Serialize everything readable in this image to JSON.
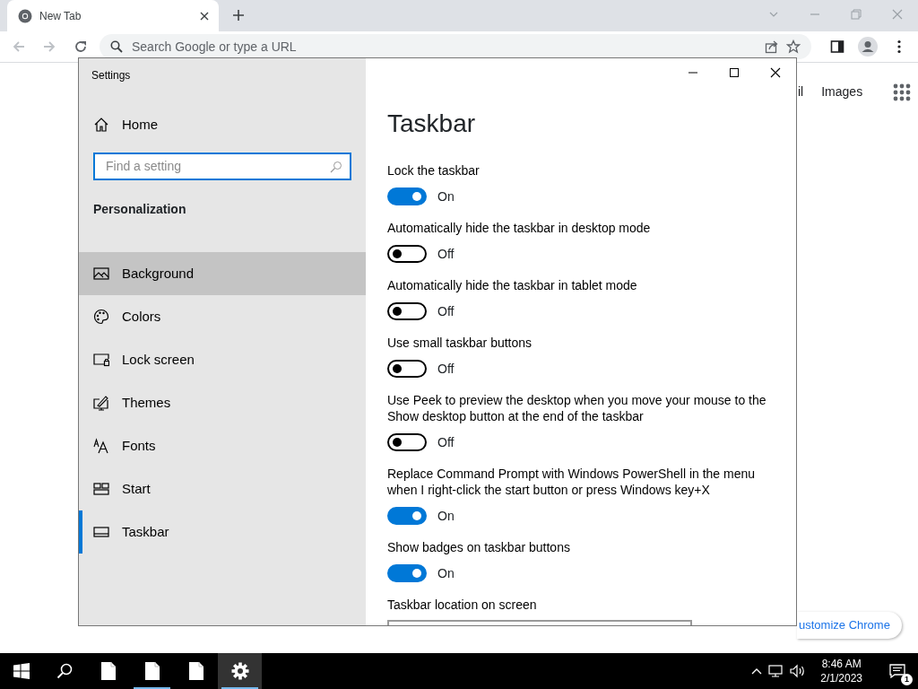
{
  "browser": {
    "tabs": [
      {
        "title": "New Tab",
        "selected": true
      }
    ],
    "back": {
      "disabled": true
    },
    "forward": {
      "disabled": true
    },
    "address_bar": {
      "placeholder": "Search Google or type a URL"
    }
  },
  "page": {
    "links": [
      "il",
      "Images"
    ],
    "customize_button": "ustomize Chrome"
  },
  "settings": {
    "title": "Settings",
    "home": "Home",
    "search": {
      "placeholder": "Find a setting"
    },
    "section": "Personalization",
    "nav": [
      {
        "label": "Background",
        "selected": false,
        "hovered": true
      },
      {
        "label": "Colors",
        "selected": false,
        "hovered": false
      },
      {
        "label": "Lock screen",
        "selected": false,
        "hovered": false
      },
      {
        "label": "Themes",
        "selected": false,
        "hovered": false
      },
      {
        "label": "Fonts",
        "selected": false,
        "hovered": false
      },
      {
        "label": "Start",
        "selected": false,
        "hovered": false
      },
      {
        "label": "Taskbar",
        "selected": true,
        "hovered": false
      }
    ],
    "heading": "Taskbar",
    "options": [
      {
        "label": "Lock the taskbar",
        "on": true,
        "state_text": "On"
      },
      {
        "label": "Automatically hide the taskbar in desktop mode",
        "on": false,
        "state_text": "Off"
      },
      {
        "label": "Automatically hide the taskbar in tablet mode",
        "on": false,
        "state_text": "Off"
      },
      {
        "label": "Use small taskbar buttons",
        "on": false,
        "state_text": "Off"
      },
      {
        "label": "Use Peek to preview the desktop when you move your mouse to the Show desktop button at the end of the taskbar",
        "on": false,
        "state_text": "Off"
      },
      {
        "label": "Replace Command Prompt with Windows PowerShell in the menu when I right-click the start button or press Windows key+X",
        "on": true,
        "state_text": "On"
      },
      {
        "label": "Show badges on taskbar buttons",
        "on": true,
        "state_text": "On"
      }
    ],
    "last_label": "Taskbar location on screen"
  },
  "taskbar": {
    "apps": [
      {
        "kind": "start",
        "running": false,
        "active": false
      },
      {
        "kind": "search",
        "running": false,
        "active": false
      },
      {
        "kind": "document",
        "running": false,
        "active": false
      },
      {
        "kind": "document",
        "running": true,
        "active": false
      },
      {
        "kind": "document",
        "running": false,
        "active": false
      },
      {
        "kind": "settings",
        "running": true,
        "active": true
      }
    ],
    "time": "8:46 AM",
    "date": "2/1/2023",
    "notifications": "1"
  }
}
